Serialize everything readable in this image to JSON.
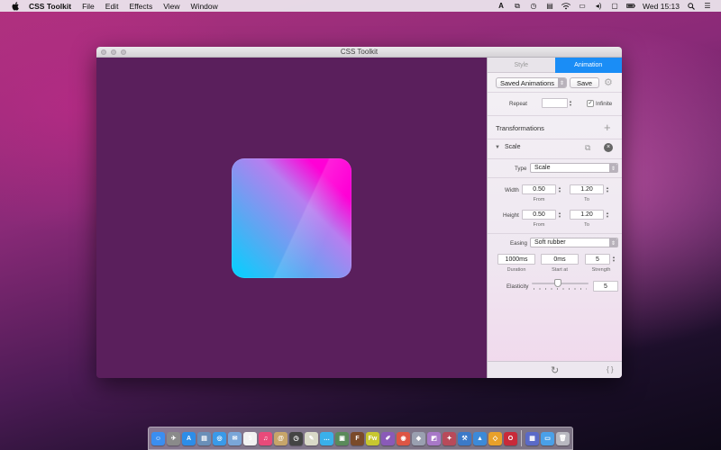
{
  "menubar": {
    "app_name": "CSS Toolkit",
    "items": [
      "File",
      "Edit",
      "Effects",
      "View",
      "Window"
    ],
    "clock": "Wed 15:13",
    "status_icons": [
      "adobe-icon",
      "box-icon",
      "clock-icon",
      "script-icon",
      "wifi-icon",
      "airplay-icon",
      "volume-icon",
      "input-source-icon",
      "battery-icon",
      "search-icon",
      "list-icon"
    ]
  },
  "window": {
    "title": "CSS Toolkit"
  },
  "preview": {
    "gradient_colors": [
      "#00d2ff",
      "#ff00d6"
    ],
    "background": "#5a1f5c"
  },
  "panel": {
    "tabs": [
      "Style",
      "Animation"
    ],
    "active_tab": "Animation",
    "saved_animations_label": "Saved Animations",
    "save_label": "Save",
    "repeat_label": "Repeat",
    "repeat_value": "",
    "infinite_label": "Infinite",
    "infinite_checked": true,
    "transformations_label": "Transformations",
    "transform_name": "Scale",
    "type_label": "Type",
    "type_value": "Scale",
    "width_label": "Width",
    "width_from": "0.50",
    "width_to": "1.20",
    "height_label": "Height",
    "height_from": "0.50",
    "height_to": "1.20",
    "from_label": "From",
    "to_label": "To",
    "easing_label": "Easing",
    "easing_value": "Soft rubber",
    "duration_value": "1000ms",
    "start_value": "0ms",
    "strength_value": "5",
    "duration_label": "Duration",
    "start_label": "Start at",
    "strength_label": "Strength",
    "elasticity_label": "Elasticity",
    "elasticity_value": "5",
    "elasticity_slider_fraction": 0.45,
    "code_label": "{ }",
    "accent_color": "#1a8df6"
  },
  "dock": {
    "icons": [
      {
        "name": "finder-icon",
        "glyph": "☺",
        "color": "#3b8ef0"
      },
      {
        "name": "launchpad-icon",
        "glyph": "✈",
        "color": "#8a8a8a"
      },
      {
        "name": "app-store-icon",
        "glyph": "A",
        "color": "#2d8de8"
      },
      {
        "name": "preview-icon",
        "glyph": "▤",
        "color": "#6a8fb8"
      },
      {
        "name": "safari-icon",
        "glyph": "◎",
        "color": "#3a9ae8"
      },
      {
        "name": "mail-icon",
        "glyph": "✉",
        "color": "#7aa6d8"
      },
      {
        "name": "calendar-icon",
        "glyph": "5",
        "color": "#f2f2f2"
      },
      {
        "name": "itunes-icon",
        "glyph": "♫",
        "color": "#e84a7a"
      },
      {
        "name": "contacts-icon",
        "glyph": "@",
        "color": "#c7a56a"
      },
      {
        "name": "clock-app-icon",
        "glyph": "◷",
        "color": "#444444"
      },
      {
        "name": "textedit-icon",
        "glyph": "✎",
        "color": "#d9d9c8"
      },
      {
        "name": "messages-icon",
        "glyph": "…",
        "color": "#3ab0ea"
      },
      {
        "name": "photos-icon",
        "glyph": "▣",
        "color": "#5a8a5a"
      },
      {
        "name": "fontbook-icon",
        "glyph": "F",
        "color": "#7a4a2a"
      },
      {
        "name": "fireworks-icon",
        "glyph": "Fw",
        "color": "#c7c730"
      },
      {
        "name": "edit-icon",
        "glyph": "✐",
        "color": "#8a5ab8"
      },
      {
        "name": "chrome-icon",
        "glyph": "◉",
        "color": "#dd5544"
      },
      {
        "name": "gem-icon",
        "glyph": "◆",
        "color": "#9aa0b0"
      },
      {
        "name": "image-tool-icon",
        "glyph": "◩",
        "color": "#a878c8"
      },
      {
        "name": "brush-icon",
        "glyph": "✦",
        "color": "#b84a5a"
      },
      {
        "name": "xcode-icon",
        "glyph": "⚒",
        "color": "#3c7ac8"
      },
      {
        "name": "keynote-icon",
        "glyph": "▲",
        "color": "#3c8ad8"
      },
      {
        "name": "sketch-icon",
        "glyph": "◇",
        "color": "#e8a02a"
      },
      {
        "name": "opera-icon",
        "glyph": "O",
        "color": "#c82a3a"
      },
      {
        "name": "sep",
        "glyph": "",
        "color": ""
      },
      {
        "name": "folder-icon",
        "glyph": "▦",
        "color": "#5a6ac8"
      },
      {
        "name": "downloads-icon",
        "glyph": "▭",
        "color": "#4aa0e8"
      },
      {
        "name": "trash-icon",
        "glyph": "🗑",
        "color": "#b8b8c0"
      }
    ]
  }
}
